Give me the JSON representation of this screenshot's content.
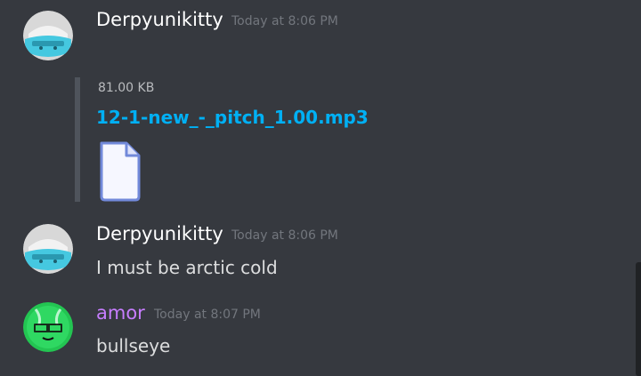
{
  "messages": [
    {
      "author": "Derpyunikitty",
      "author_color": "#ffffff",
      "timestamp": "Today at 8:06 PM",
      "attachment": {
        "size": "81.00 KB",
        "filename": "12-1-new_-_pitch_1.00.mp3",
        "icon": "file-icon"
      }
    },
    {
      "author": "Derpyunikitty",
      "author_color": "#ffffff",
      "timestamp": "Today at 8:06 PM",
      "text": "I must be arctic cold"
    },
    {
      "author": "amor",
      "author_color": "#c77dff",
      "timestamp": "Today at 8:07 PM",
      "text": "bullseye"
    }
  ],
  "colors": {
    "background": "#36393f",
    "link": "#00b0f4",
    "muted": "#72767d",
    "text": "#dcddde"
  }
}
